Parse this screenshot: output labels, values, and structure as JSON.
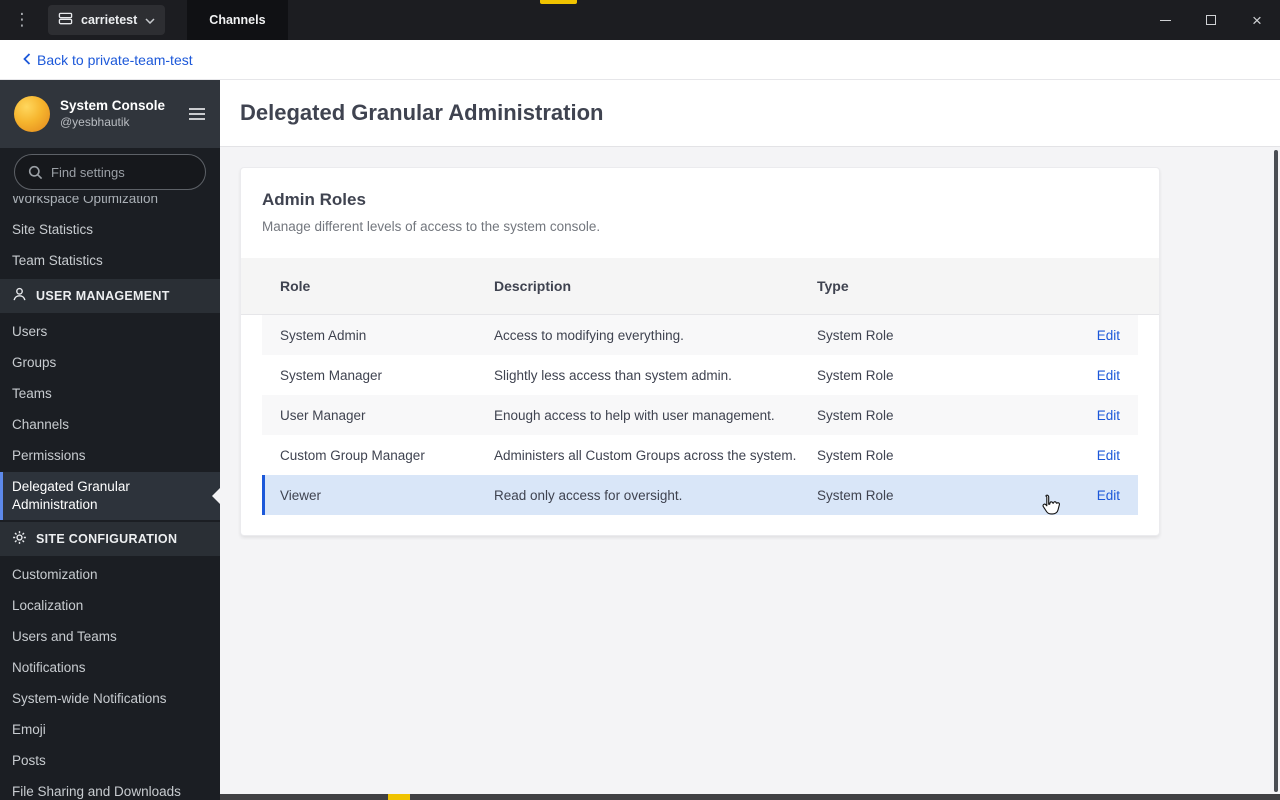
{
  "theme": {
    "accent_blue": "#1c58d9",
    "highlight_row_bg": "#d9e6f8",
    "indicator_yellow": "#f0c300"
  },
  "titlebar": {
    "app_menu_icon": "⋮",
    "team": {
      "name": "carrietest"
    },
    "active_tab": "Channels",
    "window_controls": {
      "close": "×"
    }
  },
  "backbar": {
    "label": "Back to private-team-test"
  },
  "sidebar": {
    "header": {
      "title": "System Console",
      "username": "@yesbhautik"
    },
    "search": {
      "placeholder": "Find settings"
    },
    "items_top": [
      "Workspace Optimization",
      "Site Statistics",
      "Team Statistics"
    ],
    "section_user_management": {
      "title": "USER MANAGEMENT",
      "items": [
        "Users",
        "Groups",
        "Teams",
        "Channels",
        "Permissions",
        "Delegated Granular Administration"
      ],
      "active_item": "Delegated Granular Administration"
    },
    "section_site_configuration": {
      "title": "SITE CONFIGURATION",
      "items": [
        "Customization",
        "Localization",
        "Users and Teams",
        "Notifications",
        "System-wide Notifications",
        "Emoji",
        "Posts",
        "File Sharing and Downloads"
      ]
    }
  },
  "main": {
    "page_title": "Delegated Granular Administration",
    "card": {
      "title": "Admin Roles",
      "subtitle": "Manage different levels of access to the system console.",
      "columns": {
        "role": "Role",
        "description": "Description",
        "type": "Type"
      },
      "edit_label": "Edit",
      "rows": [
        {
          "role": "System Admin",
          "description": "Access to modifying everything.",
          "type": "System Role"
        },
        {
          "role": "System Manager",
          "description": "Slightly less access than system admin.",
          "type": "System Role"
        },
        {
          "role": "User Manager",
          "description": "Enough access to help with user management.",
          "type": "System Role"
        },
        {
          "role": "Custom Group Manager",
          "description": "Administers all Custom Groups across the system.",
          "type": "System Role"
        },
        {
          "role": "Viewer",
          "description": "Read only access for oversight.",
          "type": "System Role"
        }
      ]
    }
  }
}
